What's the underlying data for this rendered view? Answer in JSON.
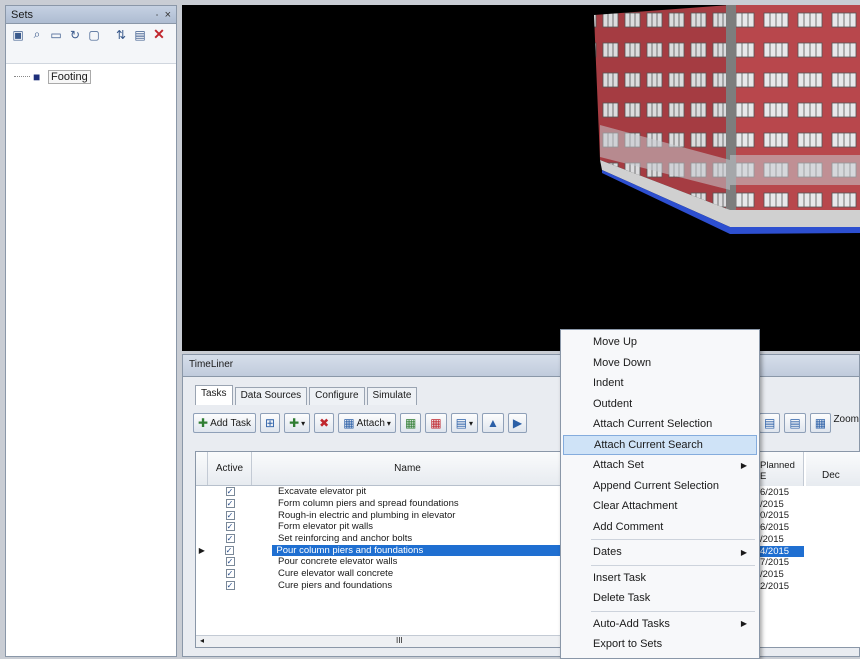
{
  "sets": {
    "title": "Sets",
    "pin_glyph": "∙",
    "close_glyph": "×",
    "toolbar_icons": [
      "save-selection-icon",
      "find-icon",
      "folder-icon",
      "refresh-set-icon",
      "comment-icon",
      "sort-icon",
      "import-export-icon",
      "delete-icon"
    ],
    "tree": [
      {
        "label": "Footing",
        "icon": "search-set-icon"
      }
    ]
  },
  "timeliner": {
    "title": "TimeLiner",
    "tabs": [
      "Tasks",
      "Data Sources",
      "Configure",
      "Simulate"
    ],
    "toolbar": {
      "add_task": "Add Task",
      "attach": "Attach",
      "zoom": "Zoom"
    },
    "columns": {
      "active": "Active",
      "name": "Name",
      "planned": "Planned E",
      "month": "Dec"
    },
    "tasks": [
      {
        "name": "Excavate elevator pit",
        "active": true,
        "planned": "6/2015"
      },
      {
        "name": "Form column piers and spread foundations",
        "active": true,
        "planned": "/2015"
      },
      {
        "name": "Rough-in electric and plumbing in elevator",
        "active": true,
        "planned": "0/2015"
      },
      {
        "name": "Form elevator pit walls",
        "active": true,
        "planned": "6/2015"
      },
      {
        "name": "Set reinforcing and anchor bolts",
        "active": true,
        "planned": "/2015"
      },
      {
        "name": "Pour column piers and foundations",
        "active": true,
        "planned": "4/2015",
        "selected": true
      },
      {
        "name": "Pour concrete elevator walls",
        "active": true,
        "planned": "7/2015"
      },
      {
        "name": "Cure elevator wall concrete",
        "active": true,
        "planned": "/2015"
      },
      {
        "name": "Cure piers and foundations",
        "active": true,
        "planned": "2/2015"
      }
    ],
    "scroll_glyph": "III"
  },
  "context_menu": {
    "items": [
      {
        "label": "Move Up"
      },
      {
        "label": "Move Down"
      },
      {
        "label": "Indent"
      },
      {
        "label": "Outdent"
      },
      {
        "label": "Attach Current Selection"
      },
      {
        "label": "Attach Current Search",
        "highlighted": true
      },
      {
        "label": "Attach Set",
        "submenu": true
      },
      {
        "label": "Append Current Selection"
      },
      {
        "label": "Clear Attachment"
      },
      {
        "label": "Add Comment"
      },
      {
        "separator": true
      },
      {
        "label": "Dates",
        "submenu": true
      },
      {
        "separator": true
      },
      {
        "label": "Insert Task"
      },
      {
        "label": "Delete Task"
      },
      {
        "separator": true
      },
      {
        "label": "Auto-Add Tasks",
        "submenu": true
      },
      {
        "label": "Export to Sets"
      }
    ]
  },
  "colors": {
    "selection": "#1f6fd1",
    "menu_highlight": "#cfe3f7",
    "building_brick": "#b8474c",
    "building_base": "#2d4fd0"
  }
}
